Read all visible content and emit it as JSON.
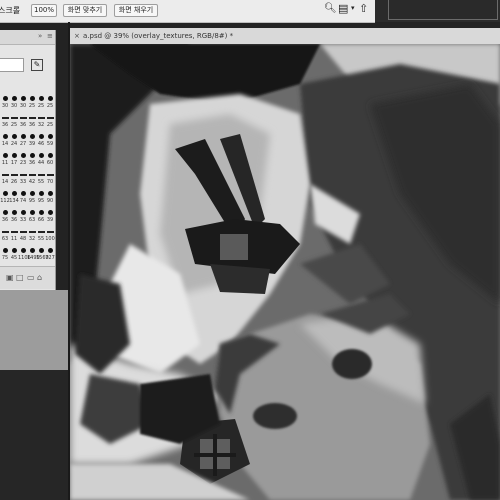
{
  "options_bar": {
    "scrubby_zoom_label": "스크롤",
    "zoom_button": "100%",
    "fit_screen_button": "화면 맞추기",
    "fill_screen_button": "화면 채우기"
  },
  "brush_panel": {
    "sizes": [
      "30",
      "30",
      "30",
      "25",
      "25",
      "25",
      "36",
      "25",
      "36",
      "36",
      "32",
      "25",
      "14",
      "24",
      "27",
      "39",
      "46",
      "59",
      "11",
      "17",
      "23",
      "36",
      "44",
      "60",
      "14",
      "26",
      "33",
      "42",
      "55",
      "70",
      "112",
      "134",
      "74",
      "95",
      "95",
      "90",
      "36",
      "36",
      "33",
      "63",
      "66",
      "39",
      "63",
      "11",
      "48",
      "32",
      "55",
      "100",
      "75",
      "45",
      "1106",
      "1499",
      "1569",
      "727",
      "290",
      "1654"
    ],
    "icons": [
      "brush-preset-icon",
      "new-brush-icon",
      "folder-icon",
      "trash-icon"
    ]
  },
  "document": {
    "tab_close": "×",
    "title": "a.psd @ 39% (overlay_textures, RGB/8#) *"
  },
  "colors": {
    "accent": "#2b2b2b",
    "panel": "#e5e5e5",
    "options": "#ececec"
  }
}
